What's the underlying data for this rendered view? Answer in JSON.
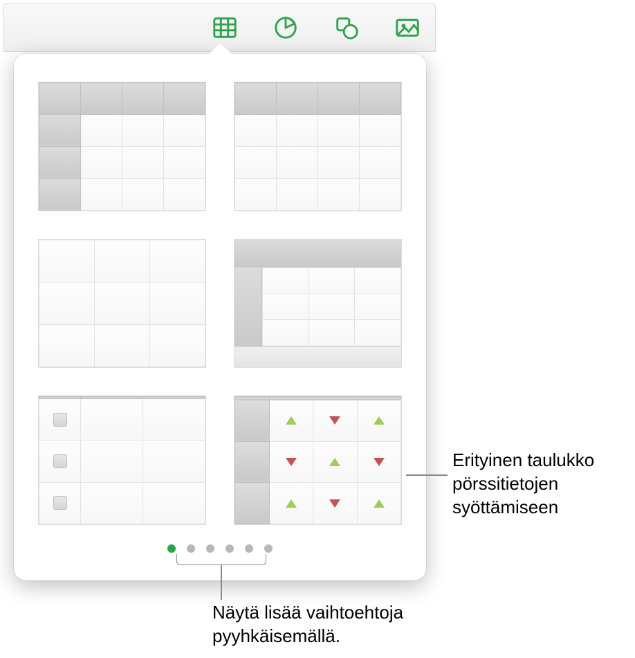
{
  "toolbar": {
    "icons": [
      "table-icon",
      "chart-icon",
      "shape-icon",
      "media-icon"
    ],
    "accent": "#2aa34a"
  },
  "popover": {
    "table_styles": [
      {
        "id": "header-row-and-col",
        "desc": "Header row + header column"
      },
      {
        "id": "header-row-only",
        "desc": "Header row only"
      },
      {
        "id": "plain",
        "desc": "No headers"
      },
      {
        "id": "banded",
        "desc": "Header row + column + footer band"
      },
      {
        "id": "checkbox",
        "desc": "Header row + checkbox first column"
      },
      {
        "id": "stock",
        "desc": "Stock-tracking table with arrows"
      }
    ],
    "page_count": 6,
    "active_page": 1,
    "stock_arrows": [
      [
        "up",
        "down",
        "up"
      ],
      [
        "down",
        "up",
        "down"
      ],
      [
        "up",
        "down",
        "up"
      ]
    ]
  },
  "callouts": {
    "stock": "Erityinen taulukko pörssitietojen syöttämiseen",
    "swipe": "Näytä lisää vaihtoehtoja pyyhkäisemällä."
  },
  "colors": {
    "up": "#9ccf5a",
    "down": "#c15352"
  }
}
